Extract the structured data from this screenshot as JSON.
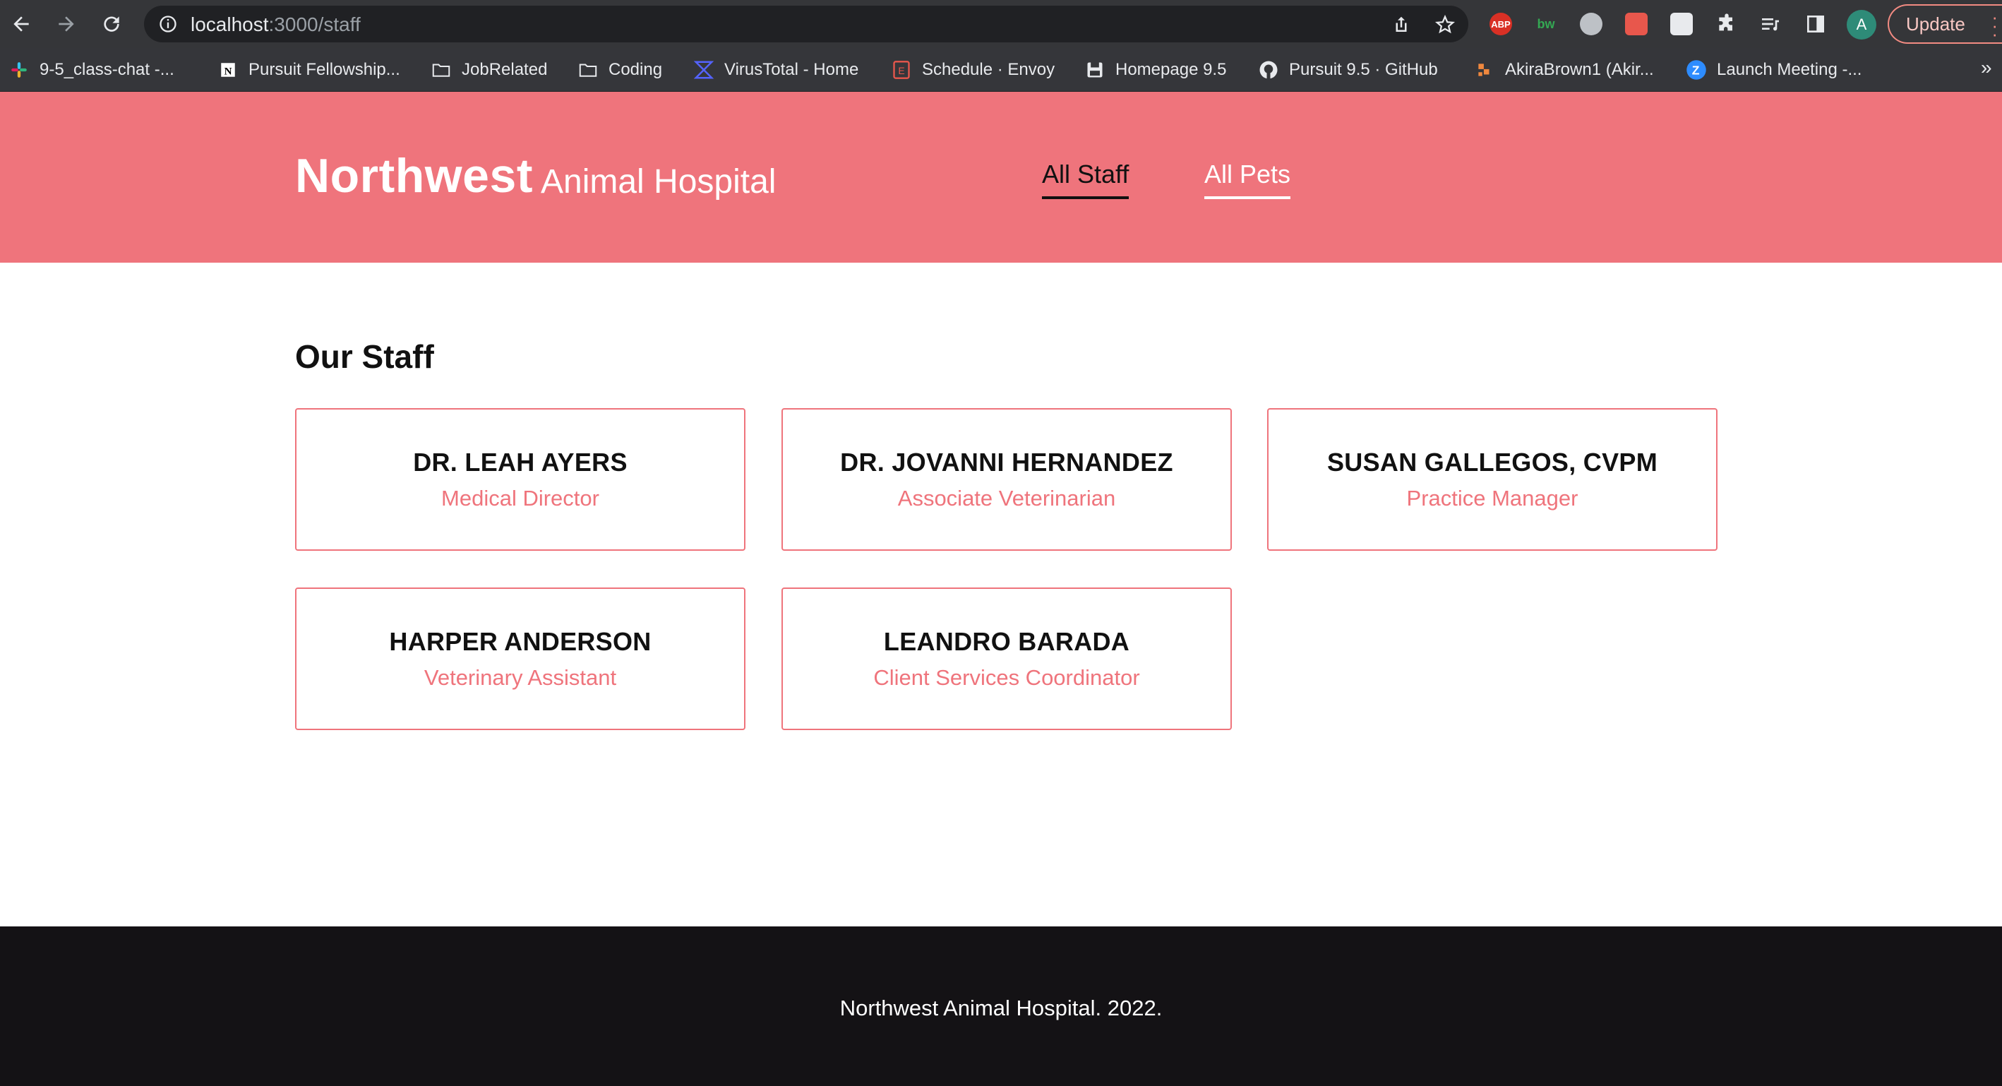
{
  "browser": {
    "url_host": "localhost",
    "url_path": ":3000/staff",
    "update_label": "Update",
    "profile_initial": "A",
    "extensions": [
      {
        "name": "adblock-plus",
        "label": "ABP",
        "color": "#d93025"
      },
      {
        "name": "bw",
        "label": "bw",
        "color": "#34a853"
      },
      {
        "name": "circle-ext",
        "label": "",
        "color": "#9aa0a6"
      },
      {
        "name": "paw-ext",
        "label": "",
        "color": "#e8574c"
      },
      {
        "name": "screenshot-ext",
        "label": "",
        "color": "#e8eaed"
      }
    ]
  },
  "bookmarks": [
    {
      "label": "9-5_class-chat -...",
      "icon": "slack-icon"
    },
    {
      "label": "Pursuit Fellowship...",
      "icon": "notion-icon"
    },
    {
      "label": "JobRelated",
      "icon": "folder-icon"
    },
    {
      "label": "Coding",
      "icon": "folder-icon"
    },
    {
      "label": "VirusTotal - Home",
      "icon": "virustotal-icon"
    },
    {
      "label": "Schedule · Envoy",
      "icon": "envoy-icon"
    },
    {
      "label": "Homepage 9.5",
      "icon": "floppy-icon"
    },
    {
      "label": "Pursuit 9.5 · GitHub",
      "icon": "github-icon"
    },
    {
      "label": "AkiraBrown1 (Akir...",
      "icon": "orange-icon"
    },
    {
      "label": "Launch Meeting -...",
      "icon": "zoom-icon"
    }
  ],
  "header": {
    "logo_main": "Northwest",
    "logo_sub": "Animal Hospital",
    "nav": [
      {
        "label": "All Staff",
        "active": true
      },
      {
        "label": "All Pets",
        "active": false
      }
    ]
  },
  "main": {
    "title": "Our Staff",
    "staff": [
      {
        "name": "DR. LEAH AYERS",
        "role": "Medical Director"
      },
      {
        "name": "DR. JOVANNI HERNANDEZ",
        "role": "Associate Veterinarian"
      },
      {
        "name": "SUSAN GALLEGOS, CVPM",
        "role": "Practice Manager"
      },
      {
        "name": "HARPER ANDERSON",
        "role": "Veterinary Assistant"
      },
      {
        "name": "LEANDRO BARADA",
        "role": "Client Services Coordinator"
      }
    ]
  },
  "footer": {
    "text": "Northwest Animal Hospital. 2022."
  },
  "colors": {
    "brand": "#ef747c",
    "footer_bg": "#141215"
  }
}
